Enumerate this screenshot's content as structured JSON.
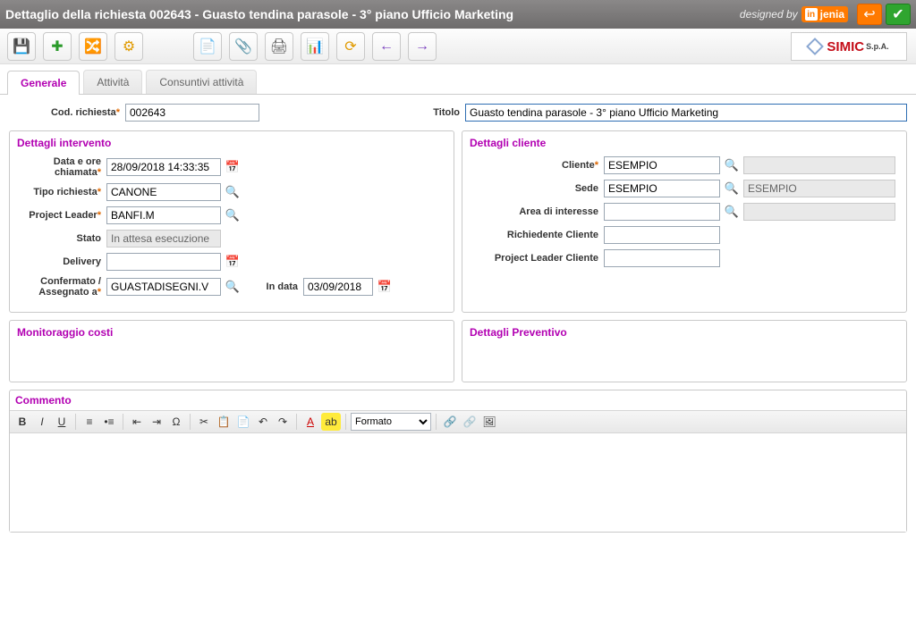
{
  "header": {
    "title": "Dettaglio della richiesta 002643 - Guasto tendina parasole - 3° piano Ufficio Marketing",
    "designed_by": "designed by",
    "brand": "jenia"
  },
  "tabs": {
    "generale": "Generale",
    "attivita": "Attività",
    "consuntivi": "Consuntivi attività"
  },
  "top": {
    "cod_label": "Cod. richiesta",
    "cod_value": "002643",
    "titolo_label": "Titolo",
    "titolo_value": "Guasto tendina parasole - 3° piano Ufficio Marketing"
  },
  "intervento": {
    "title": "Dettagli intervento",
    "data_label": "Data e ore chiamata",
    "data_value": "28/09/2018 14:33:35",
    "tipo_label": "Tipo richiesta",
    "tipo_value": "CANONE",
    "pl_label": "Project Leader",
    "pl_value": "BANFI.M",
    "stato_label": "Stato",
    "stato_value": "In attesa esecuzione",
    "delivery_label": "Delivery",
    "delivery_value": "",
    "conf_label": "Confermato / Assegnato a",
    "conf_value": "GUASTADISEGNI.V",
    "indata_label": "In data",
    "indata_value": "03/09/2018"
  },
  "cliente": {
    "title": "Dettagli cliente",
    "cliente_label": "Cliente",
    "cliente_value": "ESEMPIO",
    "sede_label": "Sede",
    "sede_value": "ESEMPIO",
    "sede_extra": "ESEMPIO",
    "area_label": "Area di interesse",
    "area_value": "",
    "rich_label": "Richiedente Cliente",
    "rich_value": "",
    "plc_label": "Project Leader Cliente",
    "plc_value": ""
  },
  "costi": {
    "title": "Monitoraggio costi"
  },
  "prev": {
    "title": "Dettagli Preventivo"
  },
  "commento": {
    "title": "Commento",
    "formato": "Formato"
  },
  "brand2": {
    "name": "SIMIC",
    "suffix": "S.p.A."
  }
}
